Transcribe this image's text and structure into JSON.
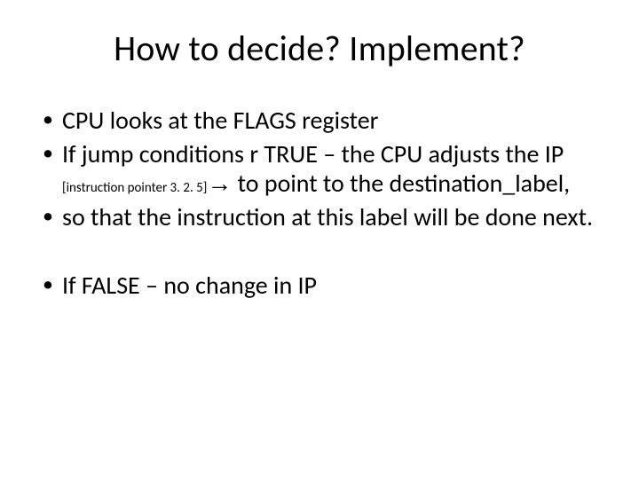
{
  "title": "How to decide? Implement?",
  "bullets": {
    "b1": "CPU looks at the FLAGS register",
    "b2_pre": "If jump conditions r TRUE – the CPU adjusts the IP ",
    "b2_note": "[instruction pointer 3. 2. 5]",
    "b2_arrow": "→",
    "b2_post": " to point to the destination_label,",
    "b3": "so that the instruction at this label will be done next.",
    "b4": "If FALSE – no change in IP"
  }
}
